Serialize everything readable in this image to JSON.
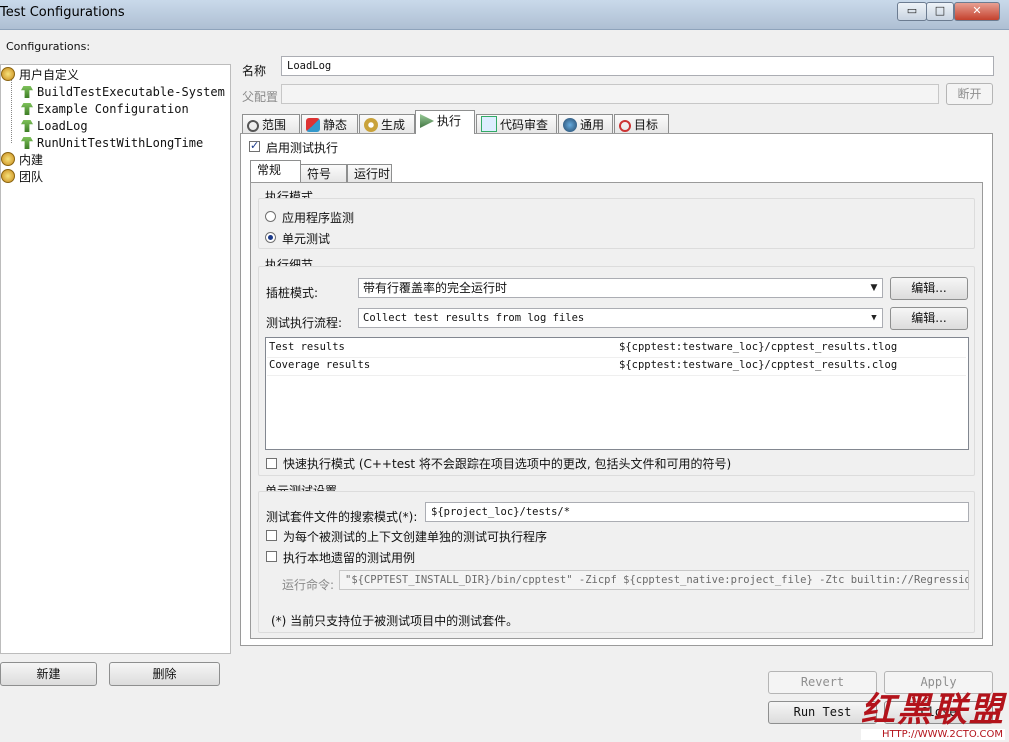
{
  "window": {
    "title": "Test Configurations",
    "minimize": "▭",
    "maximize": "□",
    "close": "✕"
  },
  "left": {
    "header": "Configurations:",
    "tree": {
      "user_defined": "用户自定义",
      "configs": [
        "BuildTestExecutable-System",
        "Example Configuration",
        "LoadLog",
        "RunUnitTestWithLongTime"
      ],
      "builtin": "内建",
      "team": "团队"
    },
    "new_button": "新建",
    "delete_button": "删除"
  },
  "form": {
    "name_label": "名称",
    "name_value": "LoadLog",
    "parent_label": "父配置",
    "parent_value": "",
    "disconnect_button": "断开"
  },
  "tabs": [
    "范围",
    "静态",
    "生成",
    "执行",
    "代码审查",
    "通用",
    "目标"
  ],
  "active_tab": "执行",
  "execute": {
    "enable_label": "启用测试执行",
    "enabled": true,
    "subtabs": [
      "常规",
      "符号",
      "运行时"
    ],
    "mode_group": {
      "title": "执行模式",
      "options": [
        "应用程序监测",
        "单元测试"
      ],
      "selected": "单元测试"
    },
    "details_group": {
      "title": "执行细节",
      "instrument_label": "插桩模式:",
      "instrument_value": "带有行覆盖率的完全运行时",
      "flow_label": "测试执行流程:",
      "flow_value": "Collect test results from log files",
      "edit_button": "编辑...",
      "results": [
        {
          "name": "Test results",
          "path": "${cpptest:testware_loc}/cpptest_results.tlog"
        },
        {
          "name": "Coverage results",
          "path": "${cpptest:testware_loc}/cpptest_results.clog"
        }
      ],
      "fast_mode_label": "快速执行模式 (C++test 将不会跟踪在项目选项中的更改, 包括头文件和可用的符号)"
    },
    "unit_group": {
      "title": "单元测试设置",
      "pattern_label": "测试套件文件的搜索模式(*):",
      "pattern_value": "${project_loc}/tests/*",
      "separate_exe_label": "为每个被测试的上下文创建单独的测试可执行程序",
      "local_legacy_label": "执行本地遗留的测试用例",
      "run_cmd_label": "运行命令:",
      "run_cmd_value": "\"${CPPTEST_INSTALL_DIR}/bin/cpptest\" -Zicpf ${cpptest_native:project_file} -Ztc builtin://RegressionTest",
      "note": "(*) 当前只支持位于被测试项目中的测试套件。"
    }
  },
  "bottom": {
    "revert": "Revert",
    "apply": "Apply",
    "run_test": "Run Test",
    "close": "Close"
  },
  "watermark": {
    "text": "红黑联盟",
    "url": "HTTP://WWW.2CTO.COM"
  }
}
